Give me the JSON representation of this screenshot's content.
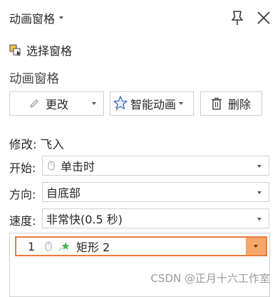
{
  "header": {
    "title": "动画窗格",
    "pin_icon": "pin-icon",
    "close_icon": "close-icon"
  },
  "selection_pane": {
    "label": "选择窗格",
    "icon": "selection-pane-icon"
  },
  "section": {
    "title": "动画窗格"
  },
  "buttons": {
    "change": "更改",
    "smart_animation": "智能动画",
    "delete": "删除"
  },
  "modify": {
    "label": "修改: 飞入"
  },
  "fields": {
    "start": {
      "label": "开始:",
      "value": "单击时"
    },
    "direction": {
      "label": "方向:",
      "value": "自底部"
    },
    "speed": {
      "label": "速度:",
      "value": "非常快(0.5 秒)"
    }
  },
  "animation_list": [
    {
      "index": "1",
      "name": "矩形 2",
      "trigger_icon": "mouse-icon",
      "effect_icon": "fly-in-effect-icon"
    }
  ],
  "watermark": "CSDN @正月十六工作室",
  "colors": {
    "selected_border": "#e87a3c",
    "dropdown_fill": "#f6a86a"
  }
}
